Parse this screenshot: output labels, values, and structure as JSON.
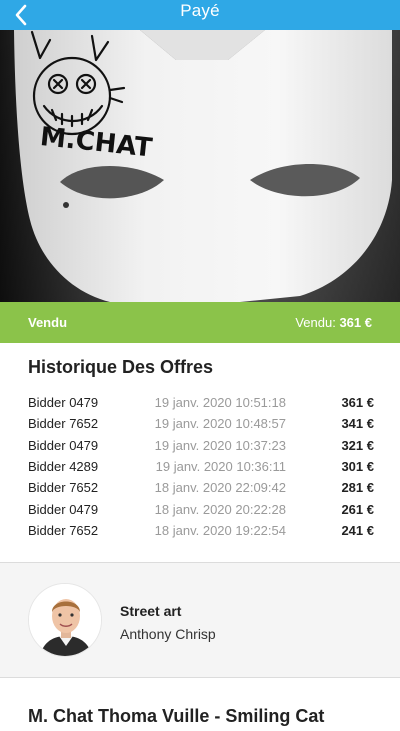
{
  "header": {
    "title": "Payé",
    "back_icon": "chevron-left-icon"
  },
  "hero": {
    "signature": "M.CHAT",
    "description_icon": "cat-mask-image"
  },
  "status": {
    "left": "Vendu",
    "right_label": "Vendu:",
    "right_value": "361 €",
    "color": "#8bc34a"
  },
  "offers": {
    "title": "Historique Des Offres",
    "rows": [
      {
        "bidder": "Bidder 0479",
        "date": "19 janv. 2020 10:51:18",
        "amount": "361 €"
      },
      {
        "bidder": "Bidder 7652",
        "date": "19 janv. 2020 10:48:57",
        "amount": "341 €"
      },
      {
        "bidder": "Bidder 0479",
        "date": "19 janv. 2020 10:37:23",
        "amount": "321 €"
      },
      {
        "bidder": "Bidder 4289",
        "date": "19 janv. 2020 10:36:11",
        "amount": "301 €"
      },
      {
        "bidder": "Bidder 7652",
        "date": "18 janv. 2020 22:09:42",
        "amount": "281 €"
      },
      {
        "bidder": "Bidder 0479",
        "date": "18 janv. 2020 20:22:28",
        "amount": "261 €"
      },
      {
        "bidder": "Bidder 7652",
        "date": "18 janv. 2020 19:22:54",
        "amount": "241 €"
      }
    ]
  },
  "artist": {
    "category": "Street art",
    "name": "Anthony Chrisp"
  },
  "lot": {
    "title": "M. Chat Thoma Vuille - Smiling Cat"
  },
  "colors": {
    "header": "#2fa8e6",
    "status": "#8bc34a",
    "muted": "#9a9a9a"
  }
}
